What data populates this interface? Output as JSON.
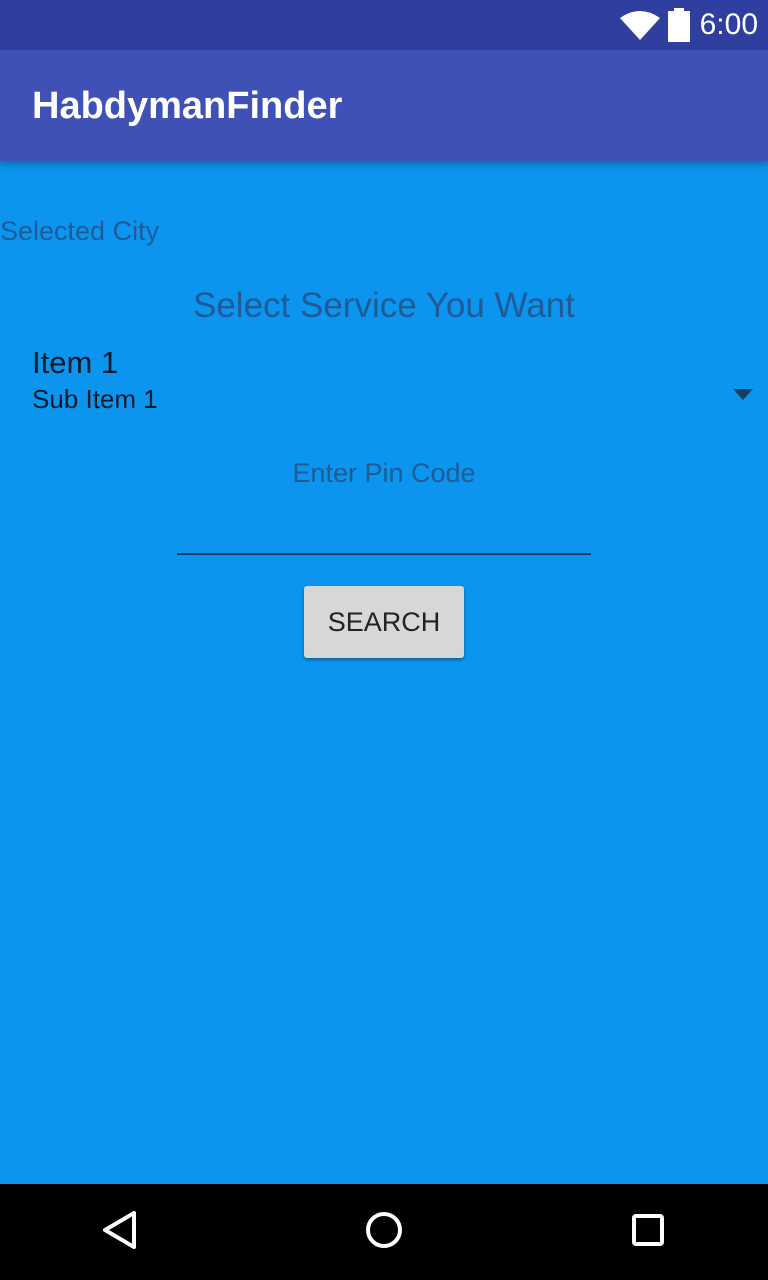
{
  "status_bar": {
    "time": "6:00",
    "icons": [
      "wifi-icon",
      "battery-icon"
    ]
  },
  "app_bar": {
    "title": "HabdymanFinder"
  },
  "main": {
    "selected_city_label": "Selected City",
    "service_heading": "Select Service You Want",
    "spinner": {
      "title": "Item 1",
      "subtitle": "Sub Item 1"
    },
    "pin_label": "Enter Pin Code",
    "pin_value": "",
    "search_button_label": "SEARCH"
  },
  "nav_bar": {
    "icons": [
      "back-icon",
      "home-icon",
      "recents-icon"
    ]
  },
  "colors": {
    "status_bar": "#303f9f",
    "app_bar": "#3f51b5",
    "background": "#0b95ee",
    "label_text": "#1e5b97",
    "button": "#d6d7d7"
  }
}
